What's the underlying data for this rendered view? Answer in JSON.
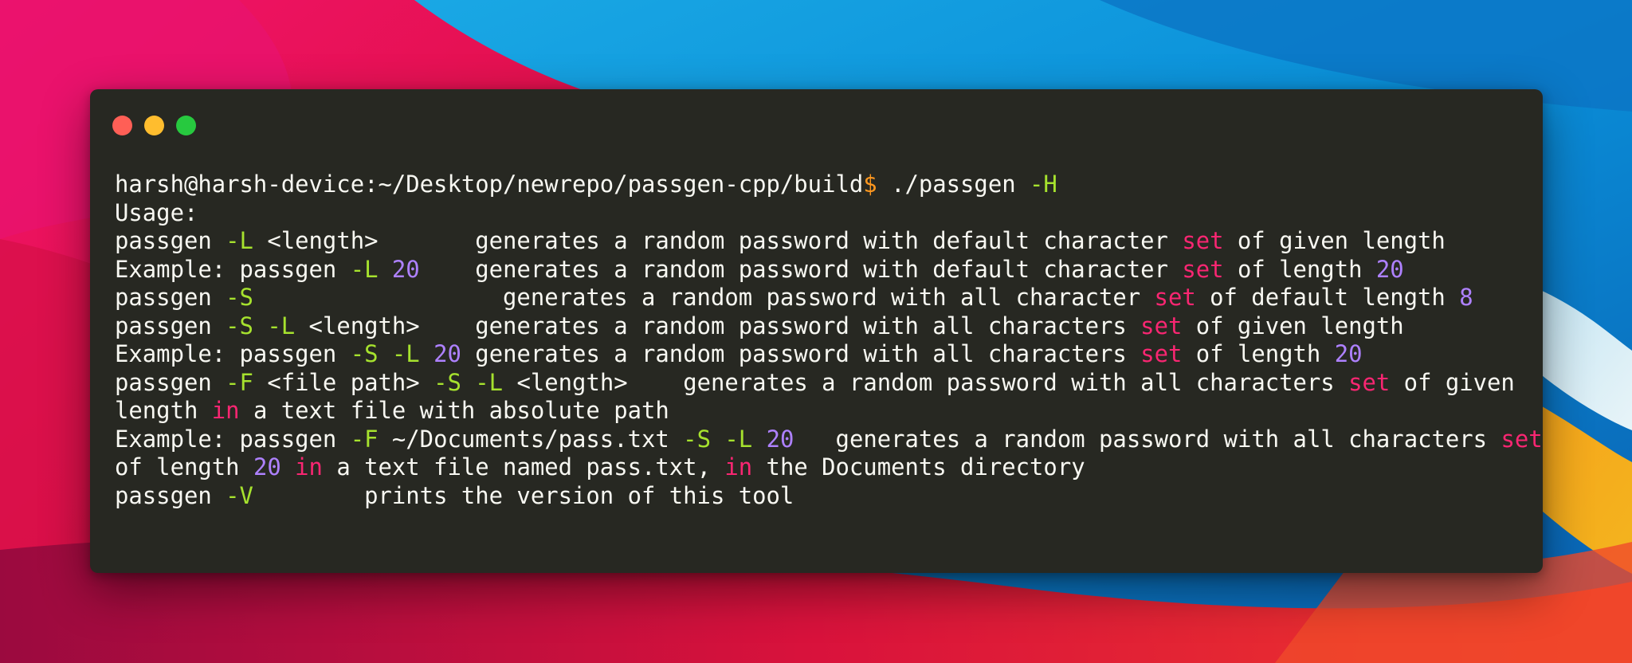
{
  "colors": {
    "terminal_bg": "#272822",
    "text": "#f8f8f2",
    "flag": "#a6e22e",
    "keyword": "#f92672",
    "number": "#ae81ff",
    "prompt_symbol": "#fd971f",
    "traffic_close": "#ff5f56",
    "traffic_minimize": "#ffbd2e",
    "traffic_zoom": "#27c93f"
  },
  "window_controls": [
    {
      "name": "close-button",
      "icon": "red-circle"
    },
    {
      "name": "minimize-button",
      "icon": "yellow-circle"
    },
    {
      "name": "zoom-button",
      "icon": "green-circle"
    }
  ],
  "terminal": {
    "lines": [
      [
        {
          "text": "harsh@harsh-device:~/Desktop/newrepo/passgen-cpp/build",
          "style": "text"
        },
        {
          "text": "$",
          "style": "prompt"
        },
        {
          "text": " ./passgen ",
          "style": "text"
        },
        {
          "text": "-H",
          "style": "flag"
        }
      ],
      [
        {
          "text": "Usage:",
          "style": "text"
        }
      ],
      [
        {
          "text": "passgen ",
          "style": "text"
        },
        {
          "text": "-L",
          "style": "flag"
        },
        {
          "text": " <length>       generates a random password with default character ",
          "style": "text"
        },
        {
          "text": "set",
          "style": "kw"
        },
        {
          "text": " of given length",
          "style": "text"
        }
      ],
      [
        {
          "text": "Example: passgen ",
          "style": "text"
        },
        {
          "text": "-L",
          "style": "flag"
        },
        {
          "text": " ",
          "style": "text"
        },
        {
          "text": "20",
          "style": "num"
        },
        {
          "text": "    generates a random password with default character ",
          "style": "text"
        },
        {
          "text": "set",
          "style": "kw"
        },
        {
          "text": " of length ",
          "style": "text"
        },
        {
          "text": "20",
          "style": "num"
        }
      ],
      [
        {
          "text": "passgen ",
          "style": "text"
        },
        {
          "text": "-S",
          "style": "flag"
        },
        {
          "text": "                  generates a random password with all character ",
          "style": "text"
        },
        {
          "text": "set",
          "style": "kw"
        },
        {
          "text": " of default length ",
          "style": "text"
        },
        {
          "text": "8",
          "style": "num"
        }
      ],
      [
        {
          "text": "passgen ",
          "style": "text"
        },
        {
          "text": "-S",
          "style": "flag"
        },
        {
          "text": " ",
          "style": "text"
        },
        {
          "text": "-L",
          "style": "flag"
        },
        {
          "text": " <length>    generates a random password with all characters ",
          "style": "text"
        },
        {
          "text": "set",
          "style": "kw"
        },
        {
          "text": " of given length",
          "style": "text"
        }
      ],
      [
        {
          "text": "Example: passgen ",
          "style": "text"
        },
        {
          "text": "-S",
          "style": "flag"
        },
        {
          "text": " ",
          "style": "text"
        },
        {
          "text": "-L",
          "style": "flag"
        },
        {
          "text": " ",
          "style": "text"
        },
        {
          "text": "20",
          "style": "num"
        },
        {
          "text": " generates a random password with all characters ",
          "style": "text"
        },
        {
          "text": "set",
          "style": "kw"
        },
        {
          "text": " of length ",
          "style": "text"
        },
        {
          "text": "20",
          "style": "num"
        }
      ],
      [
        {
          "text": "passgen ",
          "style": "text"
        },
        {
          "text": "-F",
          "style": "flag"
        },
        {
          "text": " <file path> ",
          "style": "text"
        },
        {
          "text": "-S",
          "style": "flag"
        },
        {
          "text": " ",
          "style": "text"
        },
        {
          "text": "-L",
          "style": "flag"
        },
        {
          "text": " <length>    generates a random password with all characters ",
          "style": "text"
        },
        {
          "text": "set",
          "style": "kw"
        },
        {
          "text": " of given",
          "style": "text"
        }
      ],
      [
        {
          "text": "length ",
          "style": "text"
        },
        {
          "text": "in",
          "style": "kw"
        },
        {
          "text": " a text file with absolute path",
          "style": "text"
        }
      ],
      [
        {
          "text": "Example: passgen ",
          "style": "text"
        },
        {
          "text": "-F",
          "style": "flag"
        },
        {
          "text": " ~/Documents/pass.txt ",
          "style": "text"
        },
        {
          "text": "-S",
          "style": "flag"
        },
        {
          "text": " ",
          "style": "text"
        },
        {
          "text": "-L",
          "style": "flag"
        },
        {
          "text": " ",
          "style": "text"
        },
        {
          "text": "20",
          "style": "num"
        },
        {
          "text": "   generates a random password with all characters ",
          "style": "text"
        },
        {
          "text": "set",
          "style": "kw"
        }
      ],
      [
        {
          "text": "of length ",
          "style": "text"
        },
        {
          "text": "20",
          "style": "num"
        },
        {
          "text": " ",
          "style": "text"
        },
        {
          "text": "in",
          "style": "kw"
        },
        {
          "text": " a text file named pass.txt, ",
          "style": "text"
        },
        {
          "text": "in",
          "style": "kw"
        },
        {
          "text": " the Documents directory",
          "style": "text"
        }
      ],
      [
        {
          "text": "passgen ",
          "style": "text"
        },
        {
          "text": "-V",
          "style": "flag"
        },
        {
          "text": "        prints the version of this tool",
          "style": "text"
        }
      ]
    ]
  }
}
